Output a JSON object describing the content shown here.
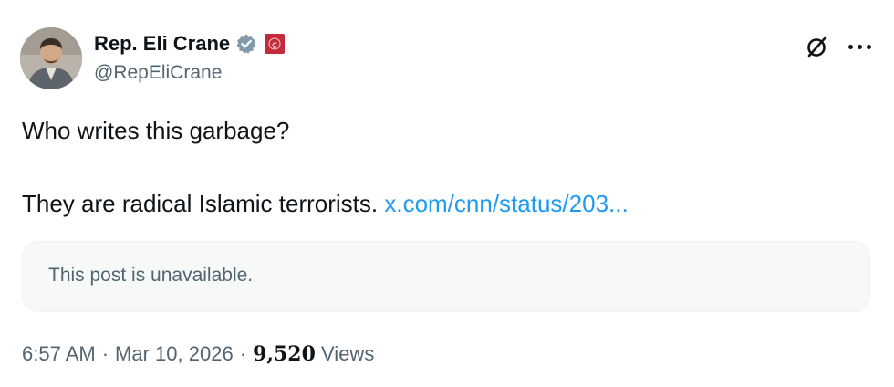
{
  "author": {
    "display_name": "Rep. Eli Crane",
    "handle": "@RepEliCrane",
    "verified_color": "#829aab",
    "affiliation_badge_color": "#c42b3b",
    "avatar_icon": "user-photo"
  },
  "actions": {
    "grok_icon": "grok-icon",
    "more_icon": "more-icon"
  },
  "post": {
    "line1": "Who writes this garbage?",
    "line2_text": "They are radical Islamic terrorists.",
    "link_text": "x.com/cnn/status/203..."
  },
  "quoted": {
    "unavailable_text": "This post is unavailable."
  },
  "meta": {
    "time": "6:57 AM",
    "separator": "·",
    "date": "Mar 10, 2026",
    "views_count": "9,520",
    "views_label": "Views"
  },
  "colors": {
    "text_primary": "#0f1419",
    "text_secondary": "#536471",
    "link": "#1d9bf0",
    "card_bg": "#f7f9f9"
  }
}
